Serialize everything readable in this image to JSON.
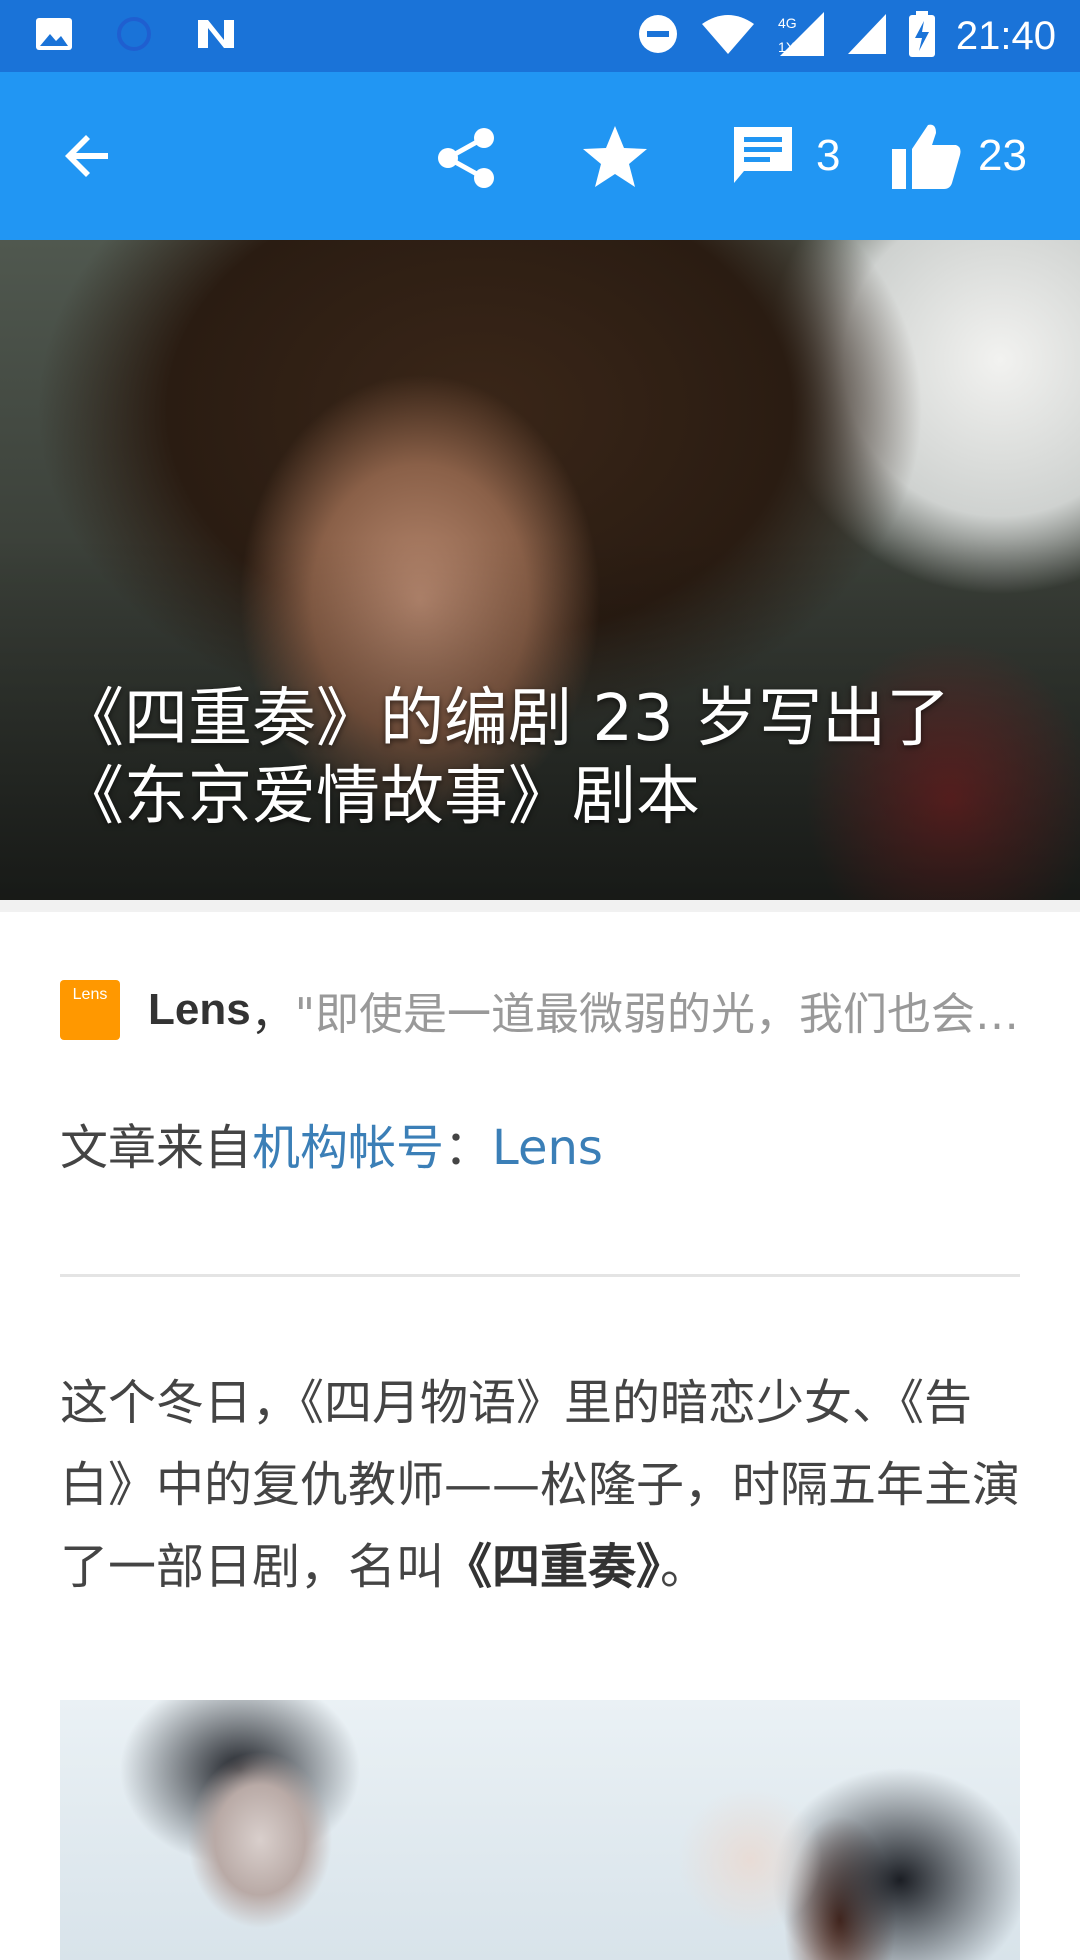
{
  "status_bar": {
    "time": "21:40",
    "network_label": "4G\n1X"
  },
  "toolbar": {
    "comment_count": "3",
    "like_count": "23"
  },
  "article": {
    "title_line1": "《四重奏》的编剧 23 岁写出了",
    "title_line2": "《东京爱情故事》剧本",
    "author": {
      "logo_text": "Lens",
      "name": "Lens",
      "separator": "，",
      "bio": "\"即使是一道最微弱的光，我们也会找到它\""
    },
    "source": {
      "prefix": "文章来自",
      "link1": "机构帐号",
      "colon": "：",
      "link2": "Lens"
    },
    "paragraph": {
      "text_before": "这个冬日，《四月物语》里的暗恋少女、《告白》中的复仇教师——松隆子，时隔五年主演了一部日剧，名叫",
      "bold": "《四重奏》",
      "text_after": "。"
    }
  },
  "colors": {
    "status_bar": "#1a73d8",
    "toolbar": "#2196f3",
    "link": "#3b7fb7",
    "logo": "#ff9800"
  }
}
